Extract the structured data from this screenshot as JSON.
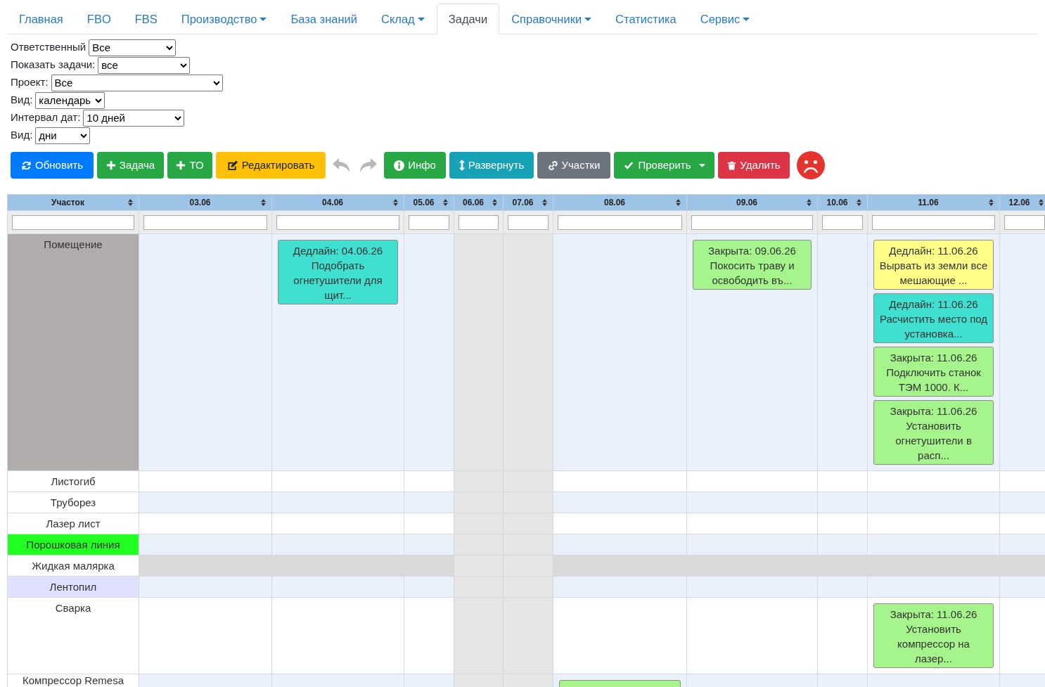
{
  "nav": {
    "tabs": [
      {
        "label": "Главная",
        "selected": false,
        "dropdown": false
      },
      {
        "label": "FBO",
        "selected": false,
        "dropdown": false
      },
      {
        "label": "FBS",
        "selected": false,
        "dropdown": false
      },
      {
        "label": "Производство",
        "selected": false,
        "dropdown": true
      },
      {
        "label": "База знаний",
        "selected": false,
        "dropdown": false
      },
      {
        "label": "Склад",
        "selected": false,
        "dropdown": true
      },
      {
        "label": "Задачи",
        "selected": true,
        "dropdown": false
      },
      {
        "label": "Справочники",
        "selected": false,
        "dropdown": true
      },
      {
        "label": "Статистика",
        "selected": false,
        "dropdown": false
      },
      {
        "label": "Сервис",
        "selected": false,
        "dropdown": true
      }
    ]
  },
  "filters": [
    {
      "label": "Ответственный",
      "value": "Все"
    },
    {
      "label": "Показать задачи:",
      "value": "все"
    },
    {
      "label": "Проект:",
      "value": "Все"
    },
    {
      "label": "Вид:",
      "value": "календарь"
    },
    {
      "label": "Интервал дат:",
      "value": "10 дней"
    },
    {
      "label": "Вид:",
      "value": "дни"
    }
  ],
  "toolbar": [
    {
      "kind": "button",
      "label": "Обновить",
      "disabled": false
    },
    {
      "kind": "button",
      "label": "Задача",
      "disabled": false
    },
    {
      "kind": "button",
      "label": "ТО",
      "disabled": false
    },
    {
      "kind": "button",
      "label": "Редактировать",
      "disabled": false
    },
    {
      "kind": "icon",
      "disabled": true
    },
    {
      "kind": "icon",
      "disabled": true
    },
    {
      "kind": "button",
      "label": "Инфо",
      "disabled": false
    },
    {
      "kind": "button",
      "label": "Развернуть",
      "disabled": false
    },
    {
      "kind": "button",
      "label": "Участки",
      "disabled": false
    },
    {
      "kind": "dropdown",
      "label": "Проверить",
      "disabled": false
    },
    {
      "kind": "button",
      "label": "Удалить",
      "disabled": false
    }
  ],
  "table": {
    "columns": [
      {
        "label": "Участок",
        "weekend": false
      },
      {
        "label": "03.06",
        "weekend": false
      },
      {
        "label": "04.06",
        "weekend": false
      },
      {
        "label": "05.06",
        "weekend": false
      },
      {
        "label": "06.06",
        "weekend": true
      },
      {
        "label": "07.06",
        "weekend": true
      },
      {
        "label": "08.06",
        "weekend": false
      },
      {
        "label": "09.06",
        "weekend": false
      },
      {
        "label": "10.06",
        "weekend": false
      },
      {
        "label": "11.06",
        "weekend": false
      },
      {
        "label": "12.06",
        "weekend": false
      }
    ],
    "rows": [
      {
        "name": "Помещение",
        "color": "#b2abab",
        "disabled": false,
        "cells": [
          {},
          {
            "tasks": [
              {
                "status": "Дедлайн: 04.06.26",
                "title": "Подобрать огнетушители для щит...",
                "color": "#40e0d0"
              }
            ]
          },
          {},
          {},
          {},
          {},
          {
            "tasks": [
              {
                "status": "Закрыта: 09.06.26",
                "title": "Покосить траву и освободить въ...",
                "color": "#a6f58c"
              }
            ]
          },
          {},
          {
            "tasks": [
              {
                "status": "Дедлайн: 11.06.26",
                "title": "Вырвать из земли все мешающие ...",
                "color": "#ffff88"
              },
              {
                "status": "Дедлайн: 11.06.26",
                "title": "Расчистить место под установка...",
                "color": "#40e0d0"
              },
              {
                "status": "Закрыта: 11.06.26",
                "title": "Подключить станок ТЭМ 1000. К...",
                "color": "#a6f58c"
              },
              {
                "status": "Закрыта: 11.06.26",
                "title": "Установить огнетушители в расп...",
                "color": "#a6f58c"
              }
            ]
          },
          {}
        ]
      },
      {
        "name": "Листогиб",
        "disabled": false
      },
      {
        "name": "Труборез",
        "disabled": false
      },
      {
        "name": "Лазер лист",
        "disabled": false
      },
      {
        "name": "Порошковая линия",
        "color": "#22ff22",
        "disabled": false
      },
      {
        "name": "Жидкая малярка",
        "disabled": true
      },
      {
        "name": "Лентопил",
        "color": "#e0e0ff",
        "disabled": false
      },
      {
        "name": "Сварка",
        "disabled": false,
        "cells": [
          {},
          {},
          {},
          {},
          {},
          {},
          {},
          {},
          {
            "tasks": [
              {
                "status": "Закрыта: 11.06.26",
                "title": "Установить компрессор на лазер...",
                "color": "#a6f58c"
              }
            ]
          },
          {}
        ]
      },
      {
        "name": "Компрессор Remesa",
        "disabled": false,
        "cells": [
          {},
          {},
          {},
          {},
          {},
          {
            "tasks": [
              {
                "color": "#a6f58c"
              }
            ]
          },
          {},
          {},
          {},
          {}
        ]
      }
    ]
  }
}
